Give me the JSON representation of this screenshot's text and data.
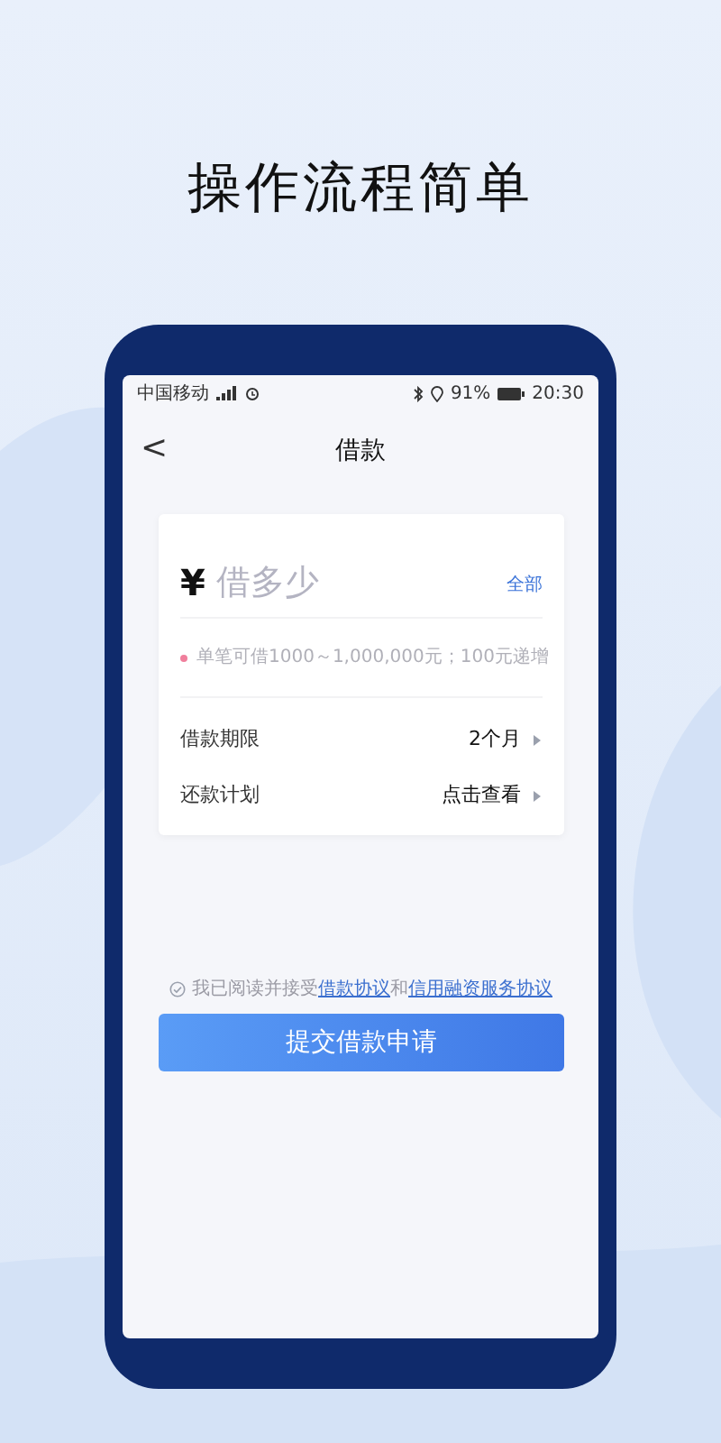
{
  "headline": "操作流程简单",
  "status_bar": {
    "carrier": "中国移动",
    "battery": "91%",
    "time": "20:30"
  },
  "nav": {
    "back": "<",
    "title": "借款"
  },
  "amount": {
    "currency": "¥",
    "placeholder": "借多少",
    "all_link": "全部"
  },
  "hint": "单笔可借1000～1,000,000元；100元递增",
  "rows": [
    {
      "label": "借款期限",
      "value": "2个月"
    },
    {
      "label": "还款计划",
      "value": "点击查看"
    }
  ],
  "agreement": {
    "checked": false,
    "prefix": "我已阅读并接受",
    "link_1": "借款协议",
    "joiner": "和",
    "link_2": "信用融资服务协议"
  },
  "submit": "提交借款申请"
}
